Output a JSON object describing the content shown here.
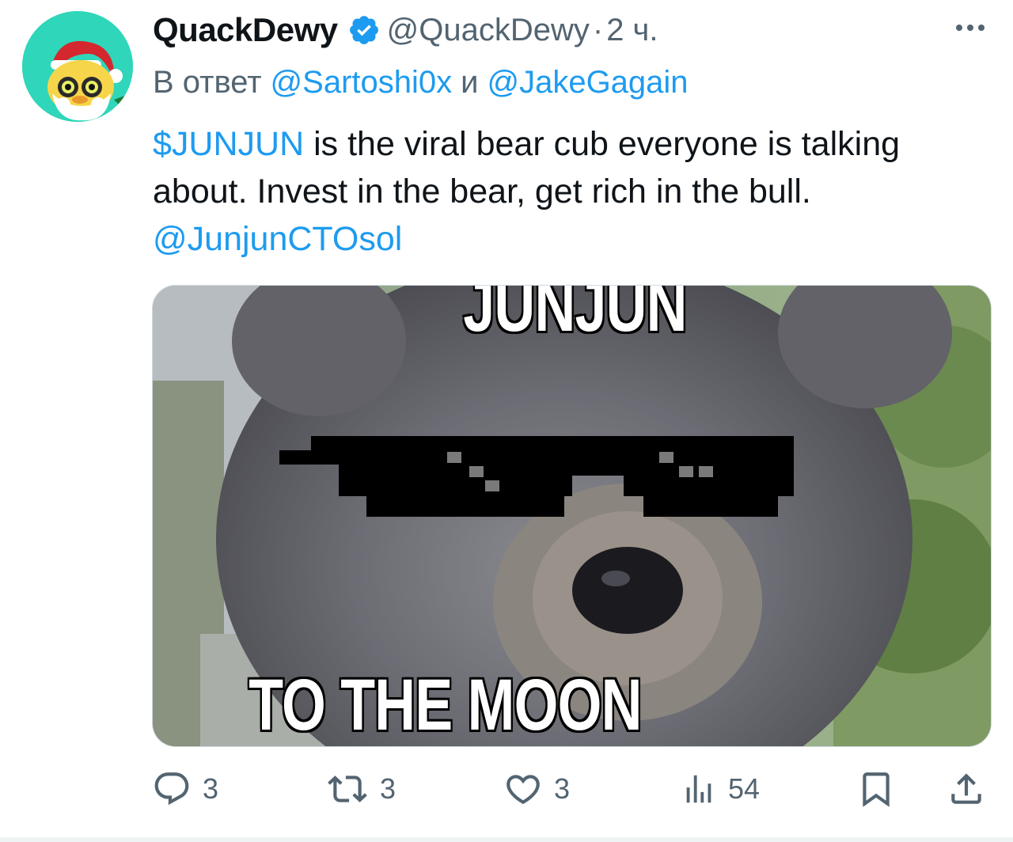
{
  "author": {
    "name": "QuackDewy",
    "handle": "@QuackDewy",
    "separator": "·",
    "time": "2 ч.",
    "verified": true
  },
  "reply": {
    "prefix": "В ответ",
    "mention_1": "@Sartoshi0x",
    "conjunction": "и",
    "mention_2": "@JakeGagain"
  },
  "text": {
    "cashtag": "$JUNJUN",
    "line1_rest": " is the viral bear cub everyone is talking",
    "line2": "about. Invest in the bear, get rich in the bull.",
    "mention": "@JunjunCTOsol"
  },
  "media": {
    "caption_top": "JUNJUN",
    "caption_bottom": "TO THE MOON"
  },
  "actions": {
    "replies": "3",
    "reposts": "3",
    "likes": "3",
    "views": "54"
  },
  "icons": {
    "more": "more-dots-icon",
    "verified": "verified-badge-icon",
    "reply": "reply-bubble-icon",
    "repost": "repost-arrows-icon",
    "like": "heart-icon",
    "views": "views-bars-icon",
    "bookmark": "bookmark-icon",
    "share": "share-upload-icon"
  },
  "colors": {
    "accent": "#1d9bf0",
    "secondary_text": "#536471",
    "primary_text": "#0f1419",
    "avatar_bg": "#2fd6b9"
  }
}
